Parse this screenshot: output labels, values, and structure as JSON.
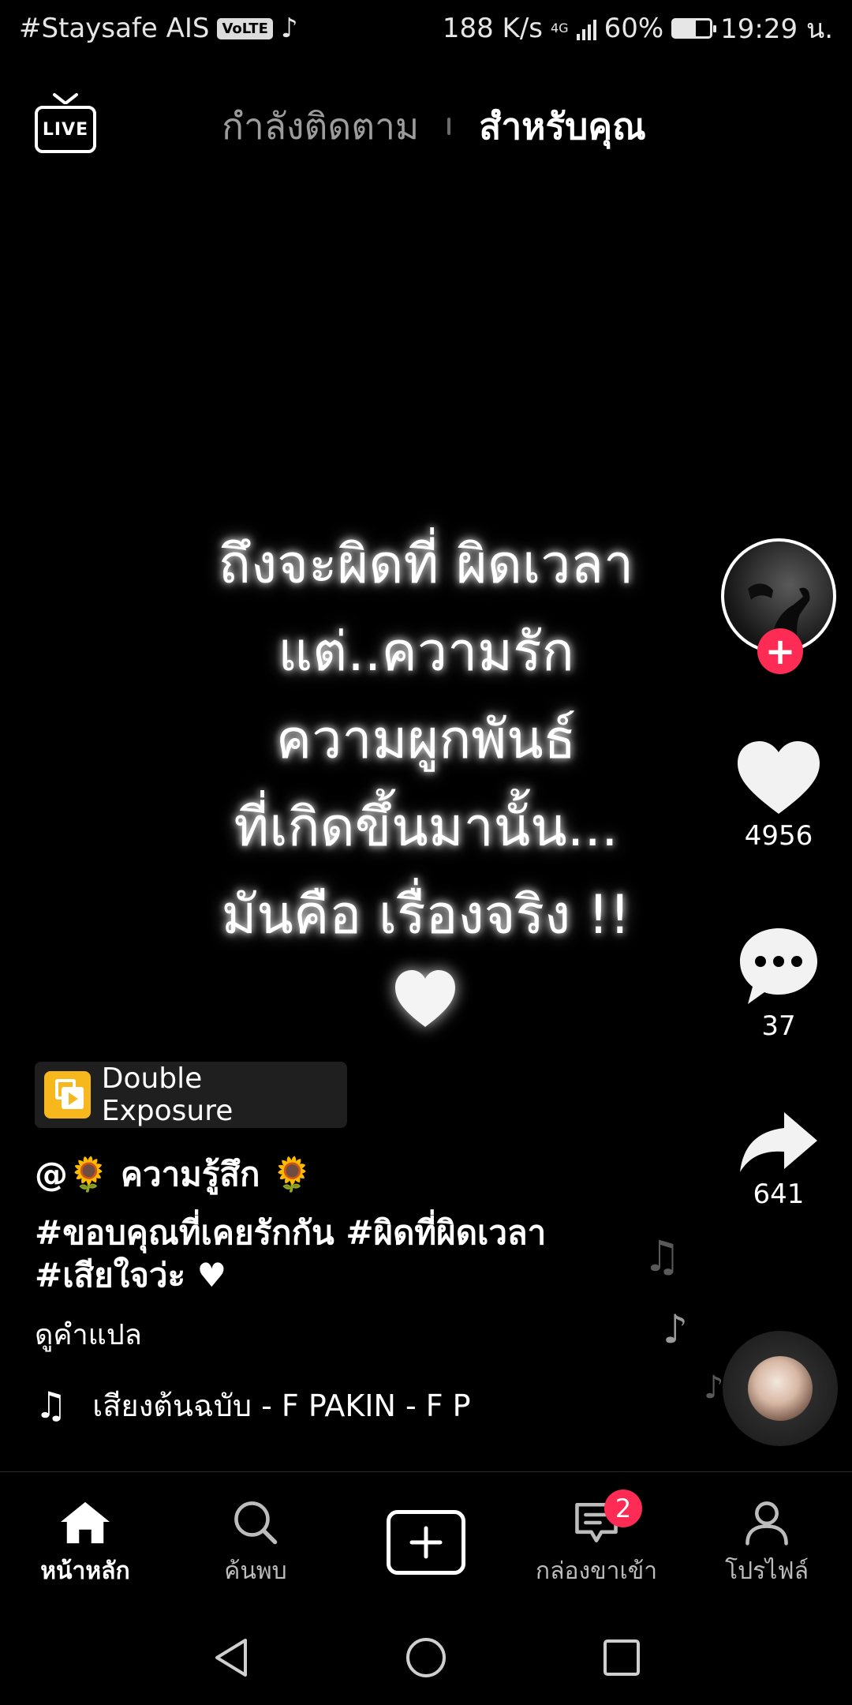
{
  "status_bar": {
    "carrier": "#Staysafe AIS",
    "volte": "VoLTE",
    "net_speed": "188 K/s",
    "network_type": "4G",
    "battery": "60%",
    "battery_level": 0.6,
    "time": "19:29 น."
  },
  "top_nav": {
    "live_label": "LIVE",
    "tabs": [
      {
        "label": "กำลังติดตาม",
        "active": false
      },
      {
        "label": "สำหรับคุณ",
        "active": true
      }
    ]
  },
  "video": {
    "text_lines": [
      "ถึงจะผิดที่ ผิดเวลา",
      "แต่..ความรัก",
      "ความผูกพันธ์",
      "ที่เกิดขึ้นมานั้น...",
      "มันคือ เรื่องจริง !!"
    ],
    "heart_icon": "white-heart-icon"
  },
  "actions": {
    "likes": "4956",
    "comments": "37",
    "shares": "641",
    "follow_icon": "plus-icon"
  },
  "post": {
    "effect_label": "Double Exposure",
    "username": "@🌻 ความรู้สึก 🌻",
    "caption_line1": "#ขอบคุณที่เคยรักกัน #ผิดที่ผิดเวลา",
    "caption_line2": "#เสียใจว่ะ ♥",
    "translate_label": "ดูคำแปล",
    "sound": "เสียงต้นฉบับ - F PAKIN - F P"
  },
  "bottom_nav": {
    "items": [
      {
        "label": "หน้าหลัก",
        "active": true
      },
      {
        "label": "ค้นพบ",
        "active": false
      },
      {
        "label": "",
        "active": false
      },
      {
        "label": "กล่องขาเข้า",
        "active": false,
        "badge": "2"
      },
      {
        "label": "โปรไฟล์",
        "active": false
      }
    ]
  },
  "colors": {
    "accent": "#fe2c55",
    "effect_icon": "#f7b81e",
    "background": "#000000"
  }
}
